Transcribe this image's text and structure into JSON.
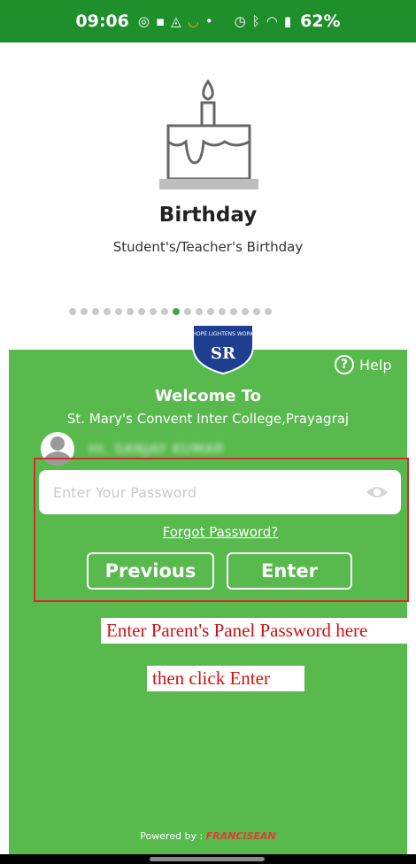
{
  "status_bar": {
    "time": "09:06",
    "icons": [
      "instagram-icon",
      "message-icon",
      "triangle-app-icon",
      "smile-app-icon",
      "dot-icon",
      "alarm-icon",
      "bluetooth-icon",
      "wifi-icon",
      "signal-icon"
    ],
    "battery": "62%"
  },
  "feature": {
    "icon": "birthday-cake-icon",
    "title": "Birthday",
    "subtitle": "Student's/Teacher's Birthday",
    "dots_total": 18,
    "dots_active_index": 9
  },
  "login": {
    "help_label": "Help",
    "welcome": "Welcome To",
    "school_name": "St. Mary's Convent Inter College,Prayagraj",
    "user_name": "HI, SANJAY KUMAR",
    "password_placeholder": "Enter Your Password",
    "forgot_password": "Forgot Password?",
    "previous_button": "Previous",
    "enter_button": "Enter"
  },
  "annotations": {
    "line1": "Enter Parent's Panel Password here",
    "line2": "then click Enter"
  },
  "footer": {
    "powered_by": "Powered by :",
    "brand": "FRANCISEAN"
  },
  "colors": {
    "status_bar": "#1f8f2c",
    "panel_green": "#58b94d",
    "highlight_red": "#d82b2b",
    "annotation_red": "#d01010",
    "active_dot": "#3aa948"
  }
}
